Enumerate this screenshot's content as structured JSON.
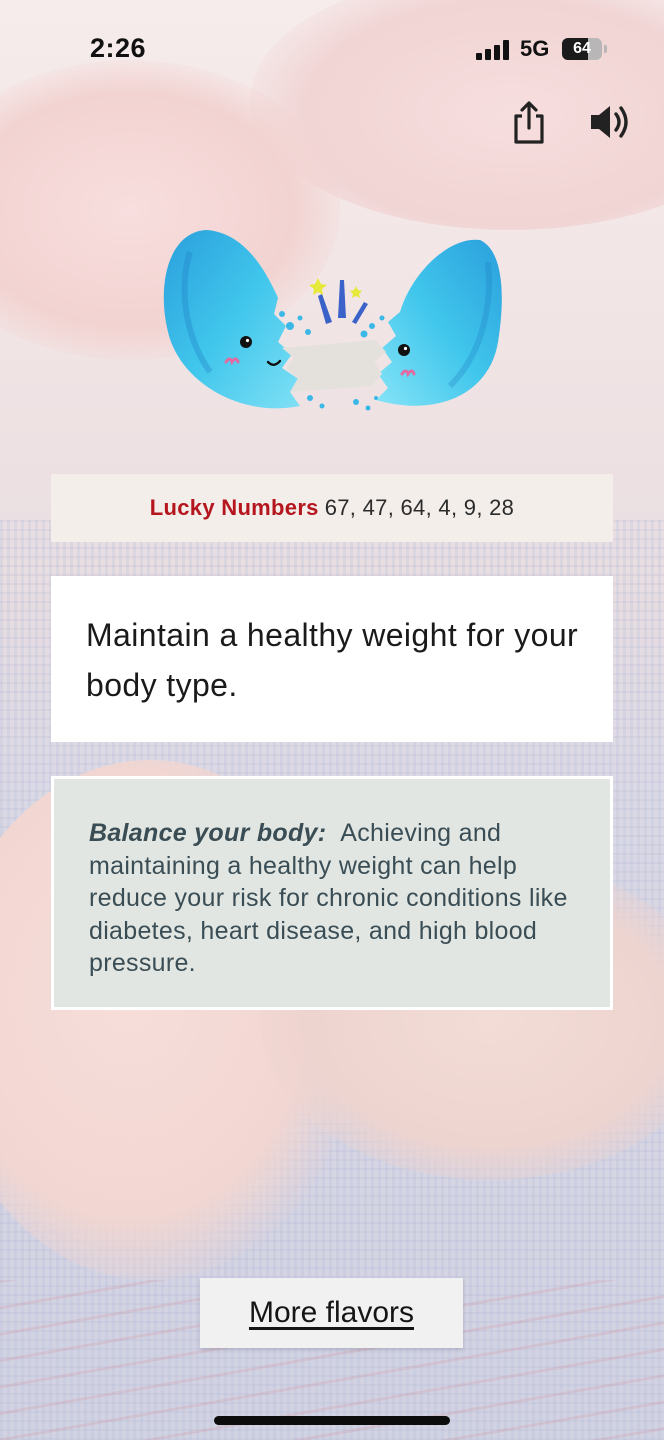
{
  "status_bar": {
    "time": "2:26",
    "network": "5G",
    "battery_percent": "64"
  },
  "actions": {
    "share_icon": "share-icon",
    "sound_icon": "speaker-icon"
  },
  "illustration": {
    "icon": "cracked-fortune-cookie-illustration",
    "colors": {
      "shell": "#3cc4ea",
      "shell_dark": "#1e8fd0",
      "paper": "#e4e1dd",
      "cheek": "#e36aa0",
      "spark_blue": "#3a62c9",
      "spark_yellow": "#e7e93a"
    }
  },
  "lucky": {
    "label": "Lucky Numbers",
    "numbers": "67, 47, 64, 4, 9, 28"
  },
  "fortune": {
    "text": "Maintain a healthy weight for your body type."
  },
  "tip": {
    "title": "Balance your body:",
    "body": "Achieving and maintaining a healthy weight can help reduce your risk for chronic conditions like diabetes, heart disease, and high blood pressure."
  },
  "more_button": {
    "label": "More flavors"
  },
  "colors": {
    "lucky_label": "#b5161d",
    "tip_background": "#e1e6e2",
    "tip_text": "#3a4d55"
  }
}
